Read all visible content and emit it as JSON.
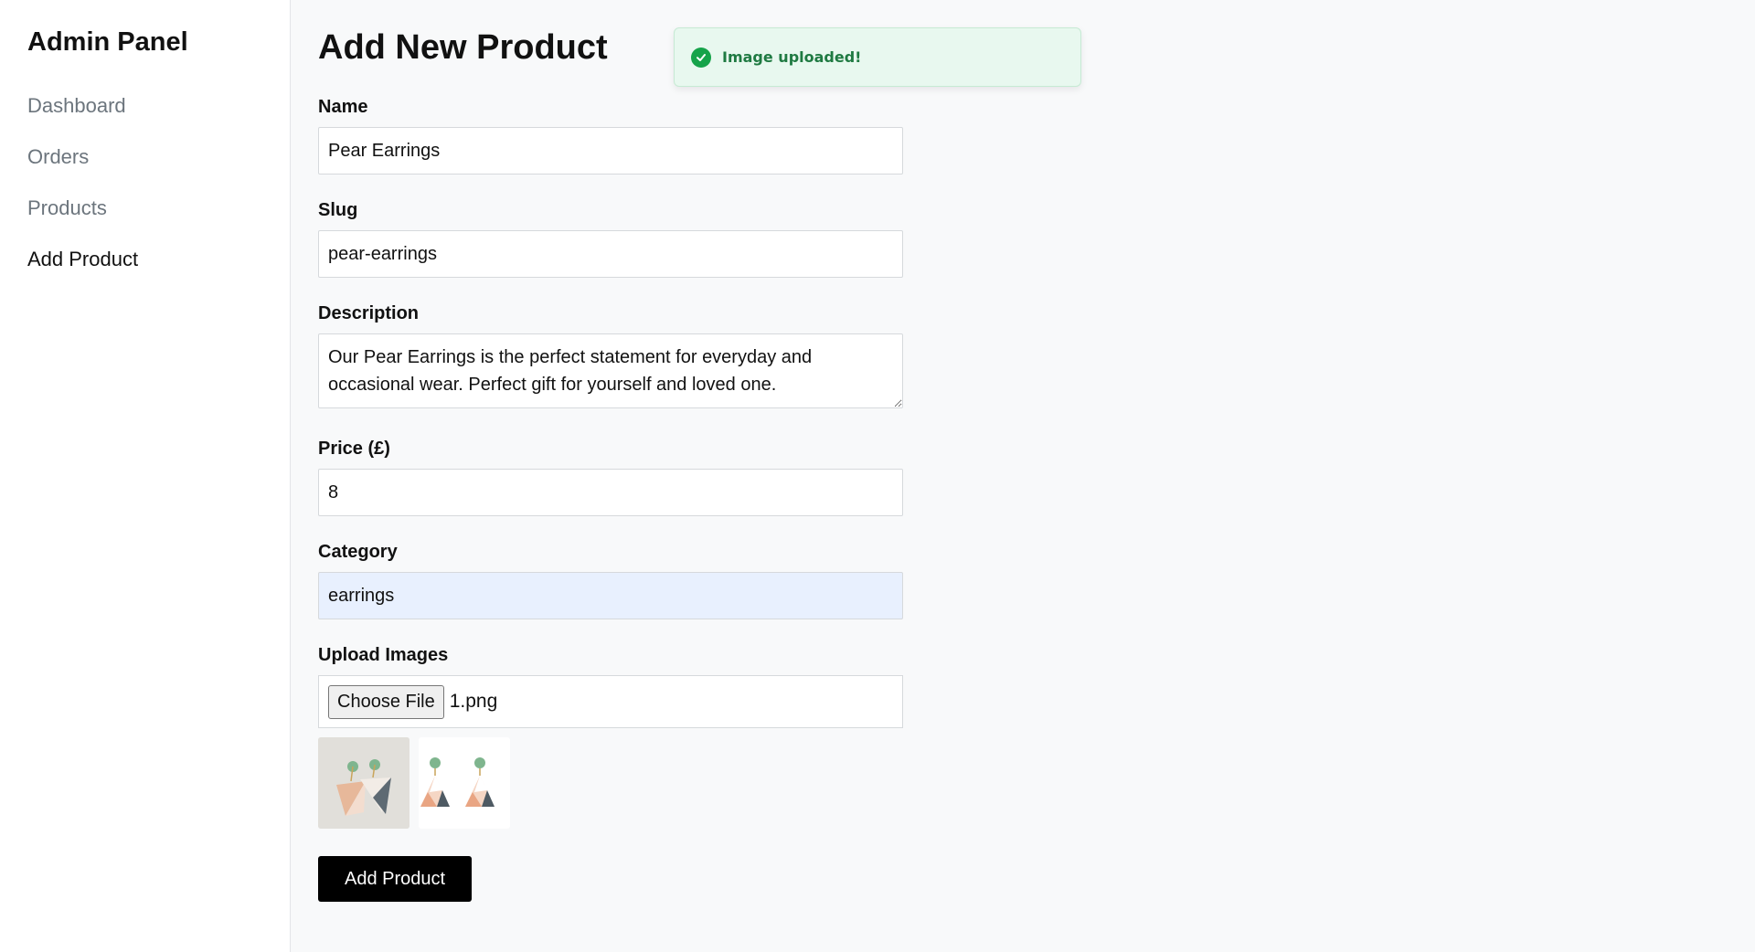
{
  "sidebar": {
    "title": "Admin Panel",
    "items": [
      {
        "label": "Dashboard"
      },
      {
        "label": "Orders"
      },
      {
        "label": "Products"
      },
      {
        "label": "Add Product"
      }
    ]
  },
  "page": {
    "title": "Add New Product"
  },
  "toast": {
    "message": "Image uploaded!",
    "icon": "check-circle-icon",
    "color": "#16a34a"
  },
  "form": {
    "name": {
      "label": "Name",
      "value": "Pear Earrings"
    },
    "slug": {
      "label": "Slug",
      "value": "pear-earrings"
    },
    "description": {
      "label": "Description",
      "value": "Our Pear Earrings is the perfect statement for everyday and occasional wear. Perfect gift for yourself and loved one."
    },
    "price": {
      "label": "Price (£)",
      "value": "8"
    },
    "category": {
      "label": "Category",
      "value": "earrings"
    },
    "upload": {
      "label": "Upload Images",
      "button_label": "Choose File",
      "file_name": "1.png"
    },
    "submit_label": "Add Product"
  }
}
